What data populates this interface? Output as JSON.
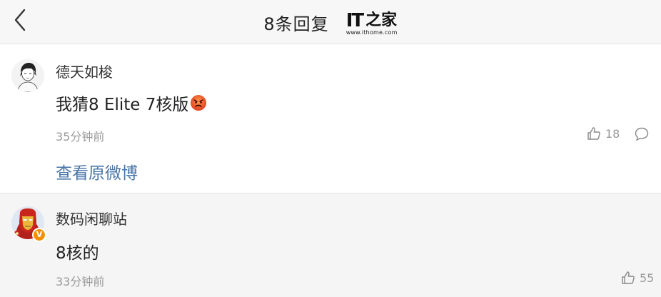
{
  "header": {
    "title": "8条回复",
    "logo_text": "IT",
    "logo_cn": "之家",
    "logo_url": "www.ithome.com"
  },
  "comments": [
    {
      "username": "德天如梭",
      "content": "我猜8 Elite 7核版",
      "emoji": "angry-face-emoji",
      "time": "35分钟前",
      "likes": "18",
      "view_original": "查看原微博"
    },
    {
      "username": "数码闲聊站",
      "content": "8核的",
      "badge": "V",
      "time": "33分钟前",
      "likes": "55"
    }
  ],
  "colors": {
    "link": "#4a76a8",
    "meta": "#999999",
    "badge": "#f29100",
    "second_comment_bg": "#f5f5f5"
  }
}
